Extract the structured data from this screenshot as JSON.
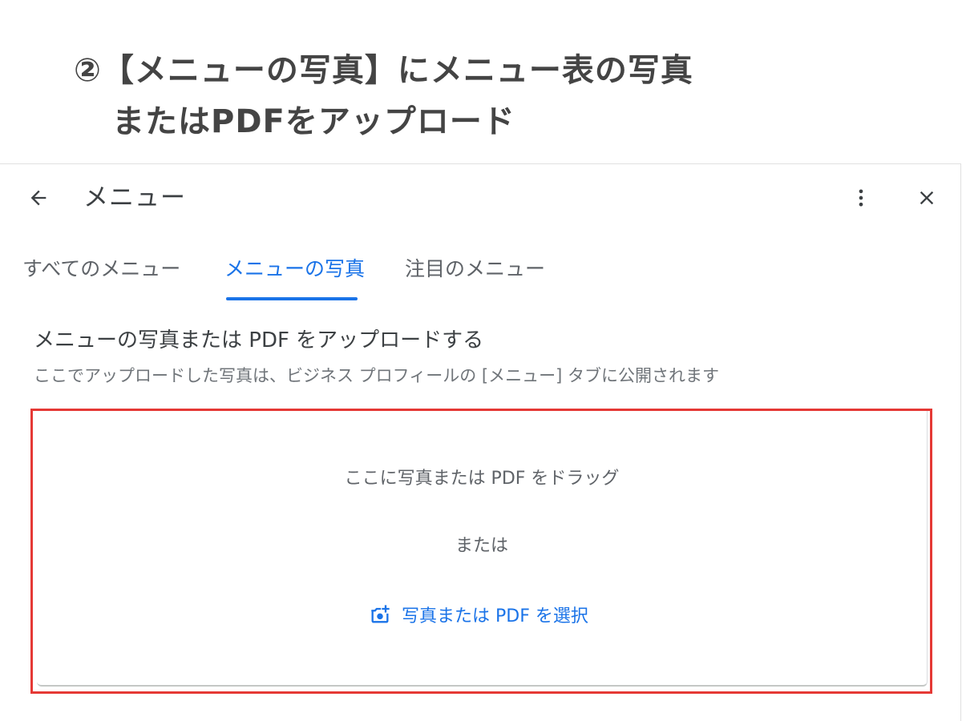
{
  "instruction": {
    "line1": "②【メニューの写真】にメニュー表の写真",
    "line2": "またはPDFをアップロード"
  },
  "header": {
    "title": "メニュー",
    "back_icon": "arrow-back-icon",
    "more_icon": "more-vert-icon",
    "close_icon": "close-icon"
  },
  "tabs": [
    {
      "label": "すべてのメニュー",
      "active": false
    },
    {
      "label": "メニューの写真",
      "active": true
    },
    {
      "label": "注目のメニュー",
      "active": false
    }
  ],
  "section": {
    "title": "メニューの写真または PDF をアップロードする",
    "subtitle": "ここでアップロードした写真は、ビジネス プロフィールの [メニュー] タブに公開されます"
  },
  "dropzone": {
    "drag_text": "ここに写真または PDF をドラッグ",
    "or_text": "または",
    "select_label": "写真または PDF を選択",
    "select_icon": "add-photo-icon"
  },
  "colors": {
    "accent": "#1a73e8",
    "highlight": "#e53935",
    "heading_text": "#444444",
    "body_text": "#3c4043",
    "muted_text": "#70757a"
  }
}
